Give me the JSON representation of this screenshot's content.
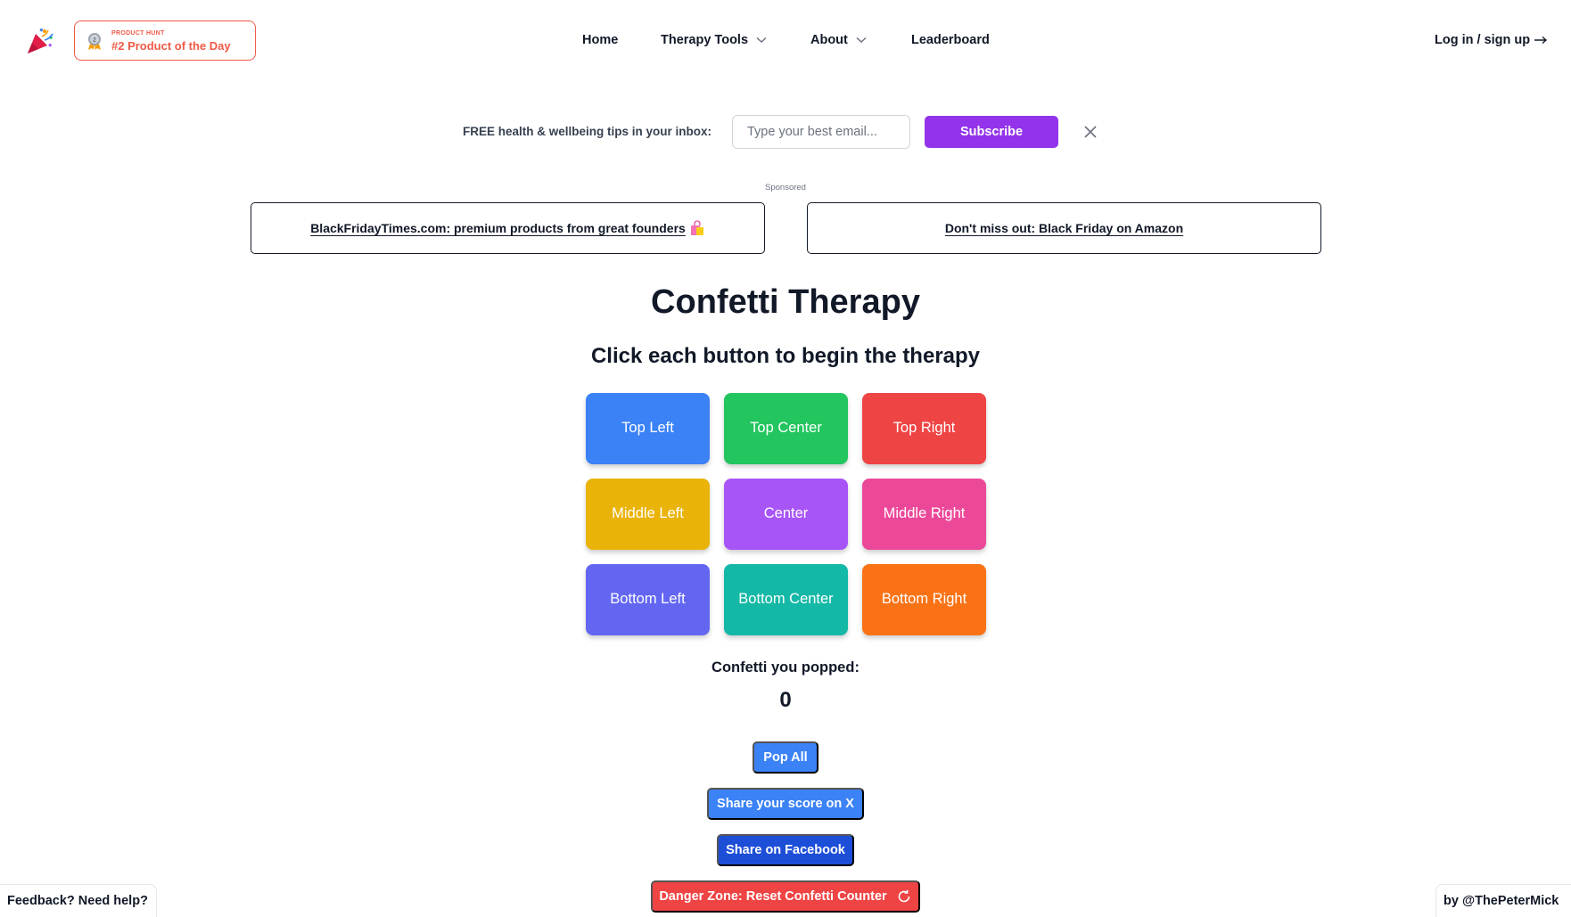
{
  "header": {
    "logo_icon": "party-popper-icon",
    "product_hunt": {
      "kicker": "PRODUCT HUNT",
      "label": "#2 Product of the Day",
      "medal_icon": "medal-icon",
      "accent": "#ef5a46"
    },
    "nav": {
      "home": "Home",
      "therapy_tools": "Therapy Tools",
      "about": "About",
      "leaderboard": "Leaderboard",
      "login": "Log in / sign up"
    }
  },
  "newsletter": {
    "label": "FREE health & wellbeing tips in your inbox:",
    "placeholder": "Type your best email...",
    "value": "",
    "button": "Subscribe",
    "close_icon": "close-icon",
    "button_color": "#9333ea"
  },
  "sponsored": {
    "label": "Sponsored",
    "ads": [
      {
        "text": "BlackFridayTimes.com: premium products from great founders",
        "icon": "shopping-bags-icon"
      },
      {
        "text": "Don't miss out: Black Friday on Amazon"
      }
    ]
  },
  "main": {
    "title": "Confetti Therapy",
    "subtitle": "Click each button to begin the therapy",
    "tiles": [
      {
        "label": "Top Left",
        "color": "#3b82f6"
      },
      {
        "label": "Top Center",
        "color": "#22c55e"
      },
      {
        "label": "Top Right",
        "color": "#ef4444"
      },
      {
        "label": "Middle Left",
        "color": "#eab308"
      },
      {
        "label": "Center",
        "color": "#a855f7"
      },
      {
        "label": "Middle Right",
        "color": "#ec4899"
      },
      {
        "label": "Bottom Left",
        "color": "#6366f1"
      },
      {
        "label": "Bottom Center",
        "color": "#14b8a6"
      },
      {
        "label": "Bottom Right",
        "color": "#f97316"
      }
    ],
    "counter_label": "Confetti you popped:",
    "counter_value": "0",
    "actions": {
      "pop_all": "Pop All",
      "share_x": "Share your score on X",
      "share_facebook": "Share on Facebook",
      "reset": "Danger Zone: Reset Confetti Counter",
      "reset_icon": "refresh-icon"
    }
  },
  "footer": {
    "feedback": "Feedback? Need help?",
    "byline": "by @ThePeterMick"
  }
}
